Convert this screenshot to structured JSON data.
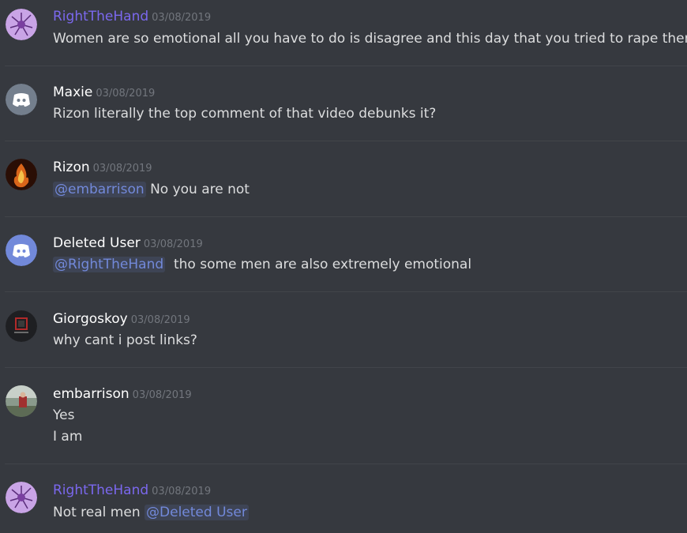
{
  "colors": {
    "background": "#36393f",
    "username_default": "#ffffff",
    "username_role": "#7b68ee",
    "timestamp": "#72767d",
    "text": "#dcddde",
    "mention": "#7289da",
    "discord_blurple": "#7289da"
  },
  "messages": [
    {
      "username": "RightTheHand",
      "timestamp": "03/08/2019",
      "avatar_icon": "purple-flower-avatar-icon",
      "lines": [
        "Women are so emotional all you have to do is disagree and this day that you tried to rape them"
      ]
    },
    {
      "username": "Maxie",
      "timestamp": "03/08/2019",
      "avatar_icon": "discord-default-avatar-icon",
      "lines": [
        "Rizon literally the top comment of that video debunks it?"
      ]
    },
    {
      "username": "Rizon",
      "timestamp": "03/08/2019",
      "avatar_icon": "fire-avatar-icon",
      "mention": "@embarrison",
      "text_after_mention": " No you are not"
    },
    {
      "username": "Deleted User",
      "timestamp": "03/08/2019",
      "avatar_icon": "discord-default-avatar-icon",
      "mention": "@RightTheHand",
      "text_after_mention": "  tho some men are also extremely emotional"
    },
    {
      "username": "Giorgoskoy",
      "timestamp": "03/08/2019",
      "avatar_icon": "dark-logo-avatar-icon",
      "lines": [
        "why cant i post links?"
      ]
    },
    {
      "username": "embarrison",
      "timestamp": "03/08/2019",
      "avatar_icon": "photo-avatar-icon",
      "lines": [
        "Yes",
        "I am"
      ]
    },
    {
      "username": "RightTheHand",
      "timestamp": "03/08/2019",
      "avatar_icon": "purple-flower-avatar-icon",
      "text_before_mention": "Not real men ",
      "mention": "@Deleted User"
    }
  ]
}
